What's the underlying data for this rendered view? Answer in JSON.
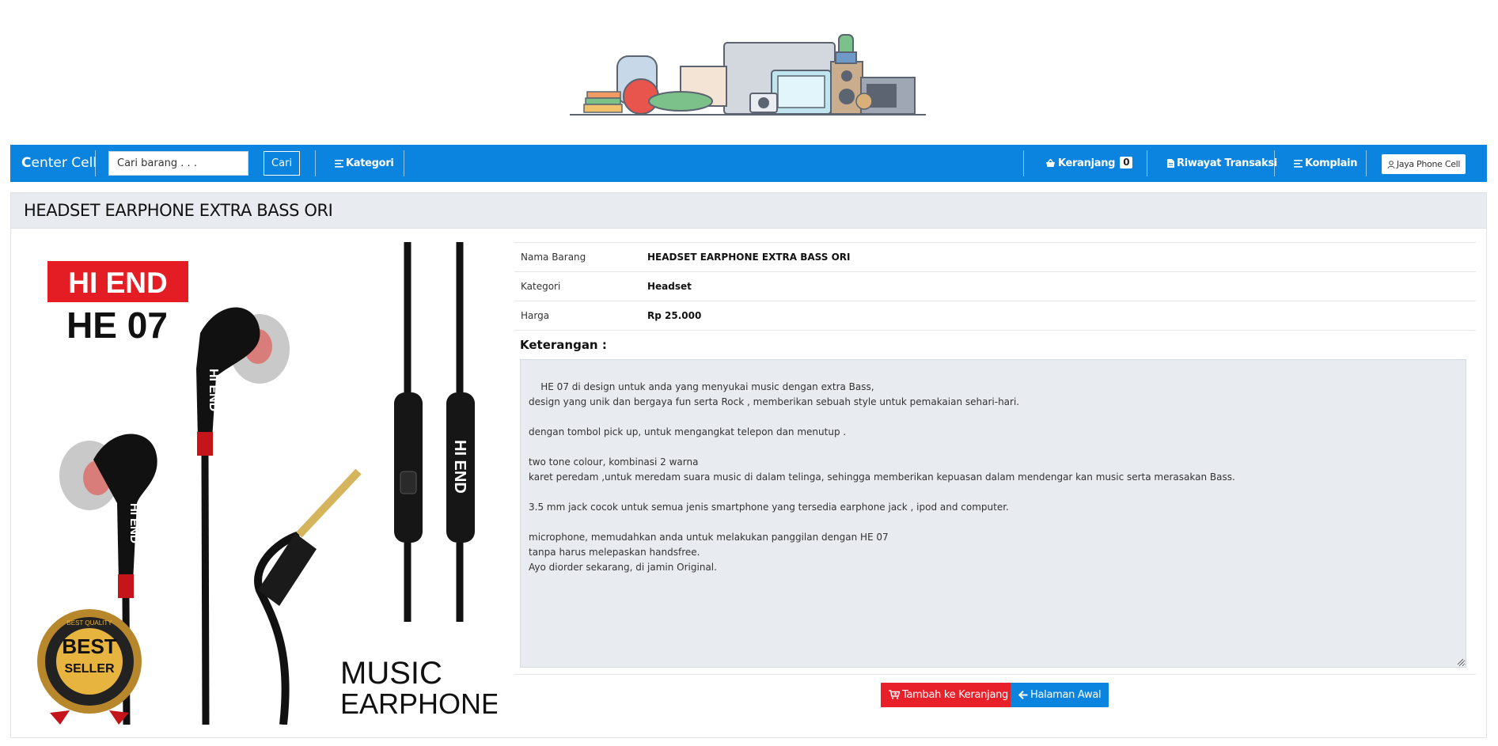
{
  "navbar": {
    "brand_initial": "C",
    "brand_rest": "enter Cell",
    "search_placeholder": "Cari barang . . .",
    "search_button": "Cari",
    "kategori": "Kategori",
    "keranjang": "Keranjang",
    "cart_count": "0",
    "riwayat": "Riwayat Transaksi",
    "komplain": "Komplain",
    "user": "Jaya Phone Cell"
  },
  "product": {
    "title": "HEADSET EARPHONE EXTRA BASS ORI",
    "image_text": {
      "brand_badge": "HI END",
      "model": "HE 07",
      "cable_label": "HI END",
      "seal_top": "BEST",
      "seal_bottom": "SELLER",
      "seal_ring": "BEST QUALITY",
      "caption_line1": "MUSIC",
      "caption_line2": "EARPHONE"
    },
    "details": [
      {
        "label": "Nama Barang",
        "value": "HEADSET EARPHONE EXTRA BASS ORI"
      },
      {
        "label": "Kategori",
        "value": "Headset"
      },
      {
        "label": "Harga",
        "value": "Rp 25.000"
      }
    ],
    "keterangan_label": "Keterangan :",
    "keterangan": "HE 07 di design untuk anda yang menyukai music dengan extra Bass,\ndesign yang unik dan bergaya fun serta Rock , memberikan sebuah style untuk pemakaian sehari-hari.\n\ndengan tombol pick up, untuk mengangkat telepon dan menutup .\n\ntwo tone colour, kombinasi 2 warna\nkaret peredam ,untuk meredam suara music di dalam telinga, sehingga memberikan kepuasan dalam mendengar kan music serta merasakan Bass.\n\n3.5 mm jack cocok untuk semua jenis smartphone yang tersedia earphone jack , ipod and computer.\n\nmicrophone, memudahkan anda untuk melakukan panggilan dengan HE 07\ntanpa harus melepaskan handsfree.\nAyo diorder sekarang, di jamin Original."
  },
  "actions": {
    "add_to_cart": "Tambah ke Keranjang",
    "home": "Halaman Awal"
  },
  "colors": {
    "navbar": "#0b84e0",
    "danger": "#e8202a",
    "panel": "#e8ebf0"
  }
}
